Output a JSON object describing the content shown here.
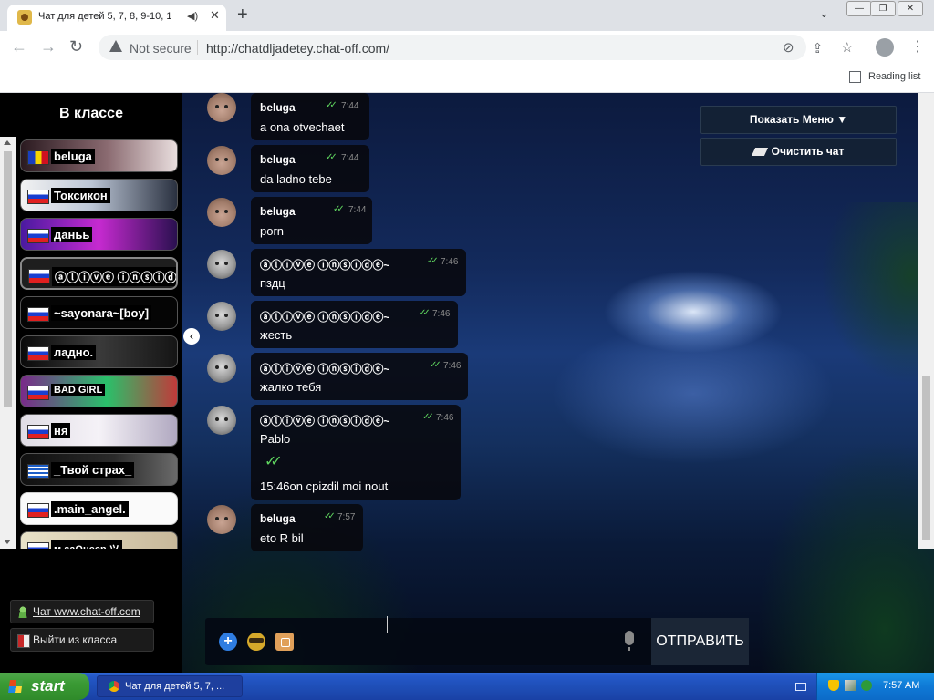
{
  "browser": {
    "tab_title": "Чат для детей 5, 7, 8, 9-10, 1",
    "not_secure": "Not secure",
    "url": "http://chatdljadetey.chat-off.com/",
    "reading_list": "Reading list"
  },
  "sidebar": {
    "title": "В классе",
    "users": [
      {
        "name": "beluga",
        "flag": "ro"
      },
      {
        "name": "Токсикон",
        "flag": "ru"
      },
      {
        "name": "даньь",
        "flag": "ru"
      },
      {
        "name": "ⓐⓛⓘⓥⓔ ⓘⓝⓢⓘⓓ",
        "flag": "ru"
      },
      {
        "name": "~sayonara~[boy]",
        "flag": "ru"
      },
      {
        "name": "ладно.",
        "flag": "ru"
      },
      {
        "name": "BAD GIRL",
        "flag": "ru"
      },
      {
        "name": "ня",
        "flag": "ru"
      },
      {
        "name": "_Твой страх_",
        "flag": "gr"
      },
      {
        "name": ".main_angel.",
        "flag": "ru"
      },
      {
        "name": "м saQueen ツ",
        "flag": "ru"
      }
    ],
    "link_chat": "Чат www.chat-off.com",
    "link_exit": "Выйти из класса"
  },
  "menu": {
    "show_menu": "Показать Меню ▼",
    "clear_chat": "Очистить чат"
  },
  "messages": [
    {
      "sender": "beluga",
      "time": "7:44",
      "text": "a ona otvechaet"
    },
    {
      "sender": "beluga",
      "time": "7:44",
      "text": "da ladno tebe"
    },
    {
      "sender": "beluga",
      "time": "7:44",
      "text": "porn"
    },
    {
      "sender": "ⓐⓛⓘⓥⓔ ⓘⓝⓢⓘⓓⓔ~",
      "time": "7:46",
      "text": "пздц"
    },
    {
      "sender": "ⓐⓛⓘⓥⓔ ⓘⓝⓢⓘⓓⓔ~",
      "time": "7:46",
      "text": "жесть"
    },
    {
      "sender": "ⓐⓛⓘⓥⓔ ⓘⓝⓢⓘⓓⓔ~",
      "time": "7:46",
      "text": "жалко тебя"
    },
    {
      "sender": "ⓐⓛⓘⓥⓔ ⓘⓝⓢⓘⓓⓔ~",
      "time": "7:46",
      "text": "Pablo",
      "text2": "15:46on cpizdil moi nout"
    },
    {
      "sender": "beluga",
      "time": "7:57",
      "text": "eto R bil"
    }
  ],
  "composer": {
    "send": "ОТПРАВИТЬ"
  },
  "taskbar": {
    "start": "start",
    "task": "Чат для детей 5, 7, ...",
    "clock": "7:57 AM"
  },
  "colors": {
    "taskbar": "#2458c8",
    "start": "#3a9a34",
    "check": "#5fd55f"
  }
}
